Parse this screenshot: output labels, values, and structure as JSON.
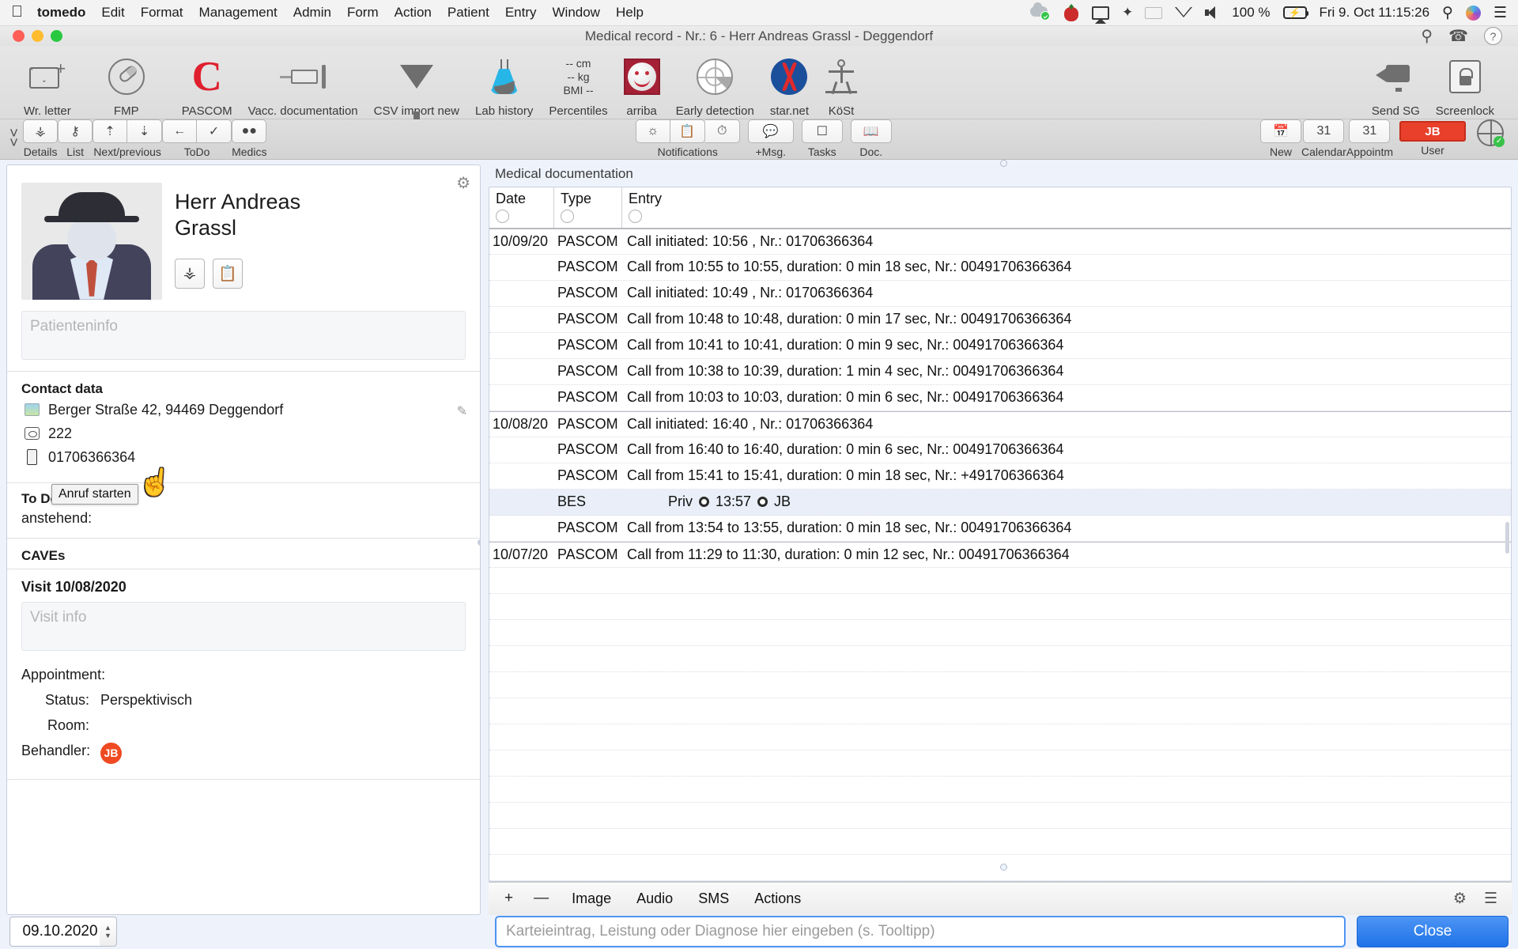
{
  "menubar": {
    "apple": "",
    "app_name": "tomedo",
    "items": [
      "Edit",
      "Format",
      "Management",
      "Admin",
      "Form",
      "Action",
      "Patient",
      "Entry",
      "Window",
      "Help"
    ],
    "status_icons": [
      "cloud-check-icon",
      "tomato-timer-icon",
      "airplay-icon",
      "bluetooth-icon",
      "german-flag-icon",
      "wifi-icon",
      "volume-icon"
    ],
    "battery_percent": "100 %",
    "clock": "Fri 9. Oct  11:15:26",
    "right_icons": [
      "spotlight-search-icon",
      "siri-icon",
      "control-center-icon"
    ]
  },
  "window": {
    "title": "Medical record - Nr.: 6 - Herr Andreas Grassl - Deggendorf",
    "title_icons": [
      "search-icon",
      "phone-icon",
      "help-icon"
    ]
  },
  "toolbar_main": {
    "items": [
      {
        "label": "Wr. letter",
        "icon": "envelope-plus-icon"
      },
      {
        "label": "FMP",
        "icon": "pill-circle-icon"
      },
      {
        "label": "PASCOM",
        "icon": "pascom-c-icon"
      },
      {
        "label": "Vacc. documentation",
        "icon": "syringe-icon"
      },
      {
        "label": "CSV import new",
        "icon": "funnel-icon"
      },
      {
        "label": "Lab history",
        "icon": "lab-flask-icon"
      },
      {
        "label": "Percentiles",
        "icon": "percentiles-icon"
      },
      {
        "label": "arriba",
        "icon": "smiley-icon"
      },
      {
        "label": "Early detection",
        "icon": "radar-icon"
      },
      {
        "label": "star.net",
        "icon": "dna-icon"
      },
      {
        "label": "KöSt",
        "icon": "vitruvian-icon"
      }
    ],
    "percentiles_lines": [
      "-- cm",
      "-- kg",
      "BMI --"
    ],
    "right_items": [
      {
        "label": "Send SG",
        "icon": "send-screen-icon"
      },
      {
        "label": "Screenlock",
        "icon": "lock-icon"
      }
    ]
  },
  "toolbar_second": {
    "groups": [
      {
        "label": "Details",
        "icons": [
          "person-icon"
        ]
      },
      {
        "label": "List",
        "icons": [
          "person-list-icon"
        ]
      },
      {
        "label": "Next/previous",
        "icons": [
          "prev-person-icon",
          "next-person-icon"
        ]
      },
      {
        "label": "ToDo",
        "icons": [
          "back-arrow-icon",
          "check-circle-icon"
        ]
      },
      {
        "label": "Medics",
        "icons": [
          "pills-icon"
        ]
      }
    ],
    "center_groups": [
      {
        "label": "Notifications",
        "icons": [
          "bell-icon",
          "clipboard-icon",
          "alarm-clock-icon"
        ]
      },
      {
        "label": "+Msg.",
        "icons": [
          "message-icon"
        ]
      },
      {
        "label": "Tasks",
        "icons": [
          "tasks-icon"
        ]
      },
      {
        "label": "Doc.",
        "icons": [
          "book-icon"
        ]
      }
    ],
    "right_groups": [
      {
        "label": "New",
        "icons": [
          "calendar-plus-icon"
        ]
      },
      {
        "label": "Calendar",
        "icons": [
          "calendar-31-icon"
        ]
      },
      {
        "label": "Appointm",
        "icons": [
          "calendar-31-alt-icon"
        ]
      },
      {
        "label": "User",
        "icons": [
          "user-badge"
        ]
      }
    ],
    "user_initials": "JB",
    "globe_icon": "globe-check-icon"
  },
  "patient": {
    "name_line1": "Herr Andreas",
    "name_line2": "Grassl",
    "avatar_icon": "avatar-placeholder",
    "action_icons": [
      "person-card-icon",
      "clipboard-icon"
    ],
    "patientinfo_placeholder": "Patienteninfo",
    "contact_title": "Contact data",
    "contact_rows": [
      {
        "icon": "map-icon",
        "value": "Berger Straße 42, 94469 Deggendorf"
      },
      {
        "icon": "phone-icon",
        "value": "222"
      },
      {
        "icon": "mobile-icon",
        "value": "01706366364"
      }
    ],
    "edit_icon": "pencil-icon",
    "tooltip": "Anruf starten",
    "cursor_icon": "pointing-hand-cursor",
    "todo_title": "To Do",
    "todo_sub": "anstehend:",
    "caves_title": "CAVEs",
    "visit_title": "Visit 10/08/2020",
    "visit_placeholder": "Visit info",
    "appointment_label": "Appointment:",
    "appointment_rows": [
      {
        "key": "Status:",
        "value": "Perspektivisch"
      },
      {
        "key": "Room:",
        "value": ""
      },
      {
        "key": "Behandler:",
        "value": "JB"
      }
    ]
  },
  "documentation": {
    "section_label": "Medical documentation",
    "columns": [
      "Date",
      "Type",
      "Entry"
    ],
    "rows": [
      {
        "date": "10/09/20",
        "type": "PASCOM",
        "entry": "Call initiated: 10:56 , Nr.: 01706366364",
        "group_start": true
      },
      {
        "date": "",
        "type": "PASCOM",
        "entry": "Call from 10:55 to 10:55, duration: 0 min 18 sec, Nr.: 00491706366364"
      },
      {
        "date": "",
        "type": "PASCOM",
        "entry": "Call initiated: 10:49 , Nr.: 01706366364"
      },
      {
        "date": "",
        "type": "PASCOM",
        "entry": "Call from 10:48 to 10:48, duration: 0 min 17 sec, Nr.: 00491706366364"
      },
      {
        "date": "",
        "type": "PASCOM",
        "entry": "Call from 10:41 to 10:41, duration: 0 min 9 sec, Nr.: 00491706366364"
      },
      {
        "date": "",
        "type": "PASCOM",
        "entry": "Call from 10:38 to 10:39, duration: 1 min 4 sec, Nr.: 00491706366364"
      },
      {
        "date": "",
        "type": "PASCOM",
        "entry": "Call from 10:03 to 10:03, duration: 0 min 6 sec, Nr.: 00491706366364"
      },
      {
        "date": "10/08/20",
        "type": "PASCOM",
        "entry": "Call initiated: 16:40 , Nr.: 01706366364",
        "group_start": true
      },
      {
        "date": "",
        "type": "PASCOM",
        "entry": "Call from 16:40 to 16:40, duration: 0 min 6 sec, Nr.: 00491706366364"
      },
      {
        "date": "",
        "type": "PASCOM",
        "entry": "Call from 15:41 to 15:41, duration: 0 min 18 sec, Nr.: +491706366364"
      },
      {
        "date": "",
        "type": "BES",
        "entry": "Priv ◉ 13:57 ◉ JB",
        "selected": true
      },
      {
        "date": "",
        "type": "PASCOM",
        "entry": "Call from 13:54 to 13:55, duration: 0 min 18 sec, Nr.: 00491706366364"
      },
      {
        "date": "10/07/20",
        "type": "PASCOM",
        "entry": "Call from 11:29 to 11:30, duration: 0 min 12 sec, Nr.: 00491706366364",
        "group_start": true
      }
    ],
    "bottom_bar": {
      "add": "+",
      "remove": "—",
      "tabs": [
        "Image",
        "Audio",
        "SMS",
        "Actions"
      ],
      "right_icons": [
        "gear-icon",
        "list-icon"
      ]
    }
  },
  "footer": {
    "date_value": "09.10.2020",
    "entry_placeholder": "Karteieintrag, Leistung oder Diagnose hier eingeben (s. Tooltipp)",
    "close_label": "Close"
  }
}
